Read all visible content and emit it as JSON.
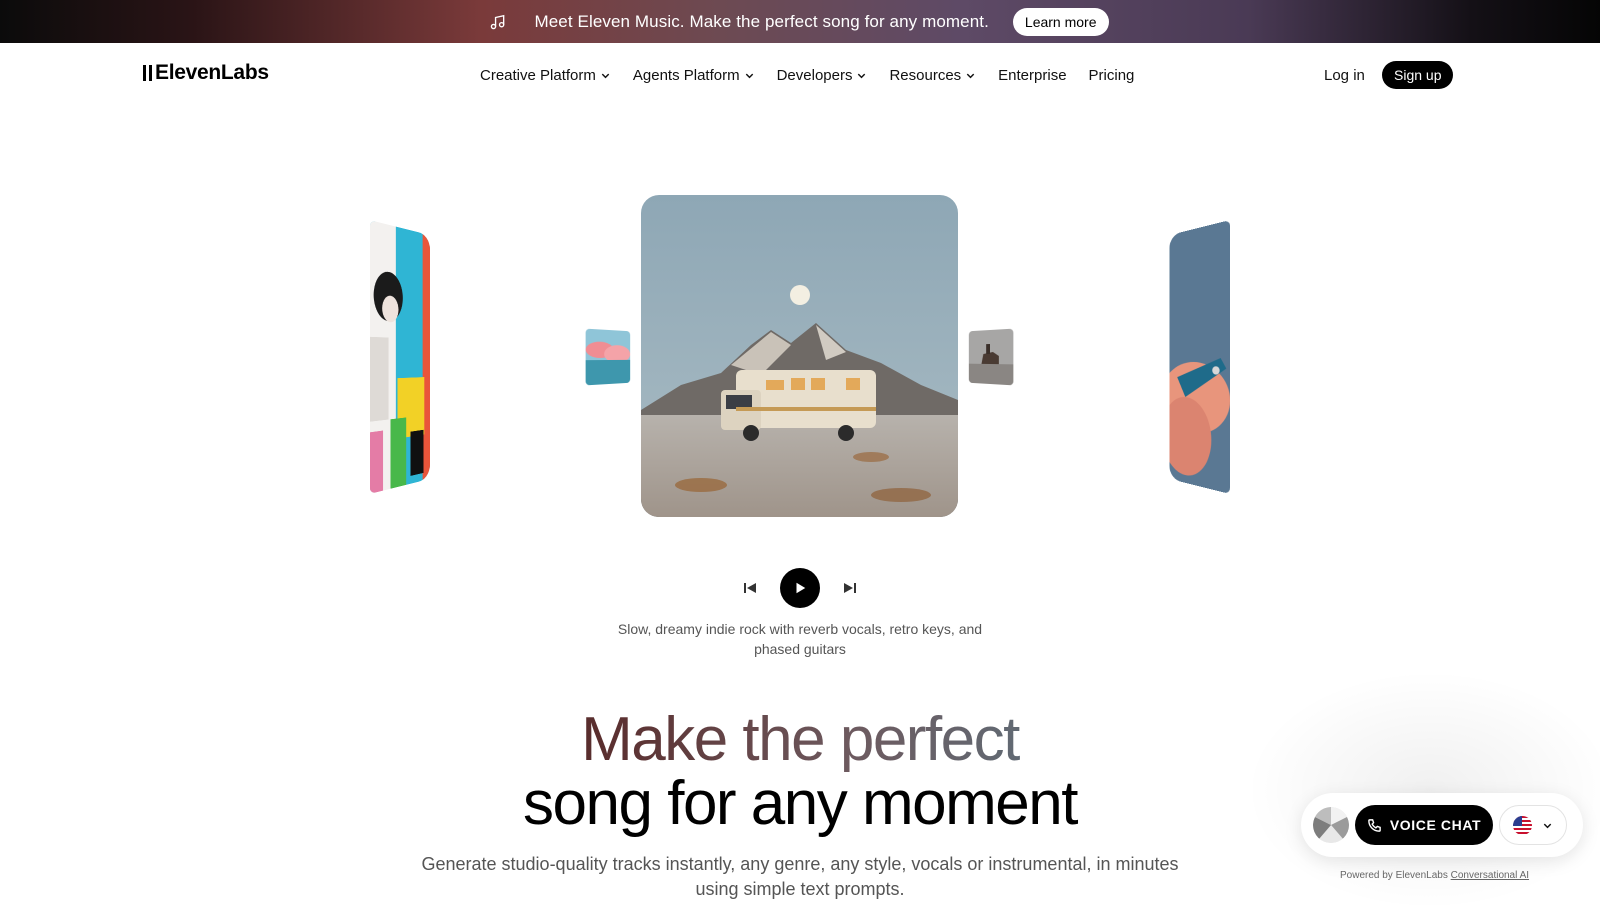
{
  "banner": {
    "icon": "music-note-icon",
    "text": "Meet Eleven Music. Make the perfect song for any moment.",
    "cta": "Learn more"
  },
  "nav": {
    "logo": "ElevenLabs",
    "items": [
      {
        "label": "Creative Platform",
        "dropdown": true
      },
      {
        "label": "Agents Platform",
        "dropdown": true
      },
      {
        "label": "Developers",
        "dropdown": true
      },
      {
        "label": "Resources",
        "dropdown": true
      },
      {
        "label": "Enterprise",
        "dropdown": false
      },
      {
        "label": "Pricing",
        "dropdown": false
      }
    ],
    "login": "Log in",
    "signup": "Sign up"
  },
  "carousel": {
    "caption": "Slow, dreamy indie rock with reverb vocals, retro keys, and phased guitars"
  },
  "hero": {
    "headline_1": "Make the perfect",
    "headline_2": "song for any moment",
    "subtext": "Generate studio-quality tracks instantly, any genre, any style, vocals or instrumental, in minutes using simple text prompts."
  },
  "widget": {
    "voice_chat": "VOICE CHAT",
    "powered_prefix": "Powered by ElevenLabs",
    "powered_link": "Conversational AI"
  }
}
